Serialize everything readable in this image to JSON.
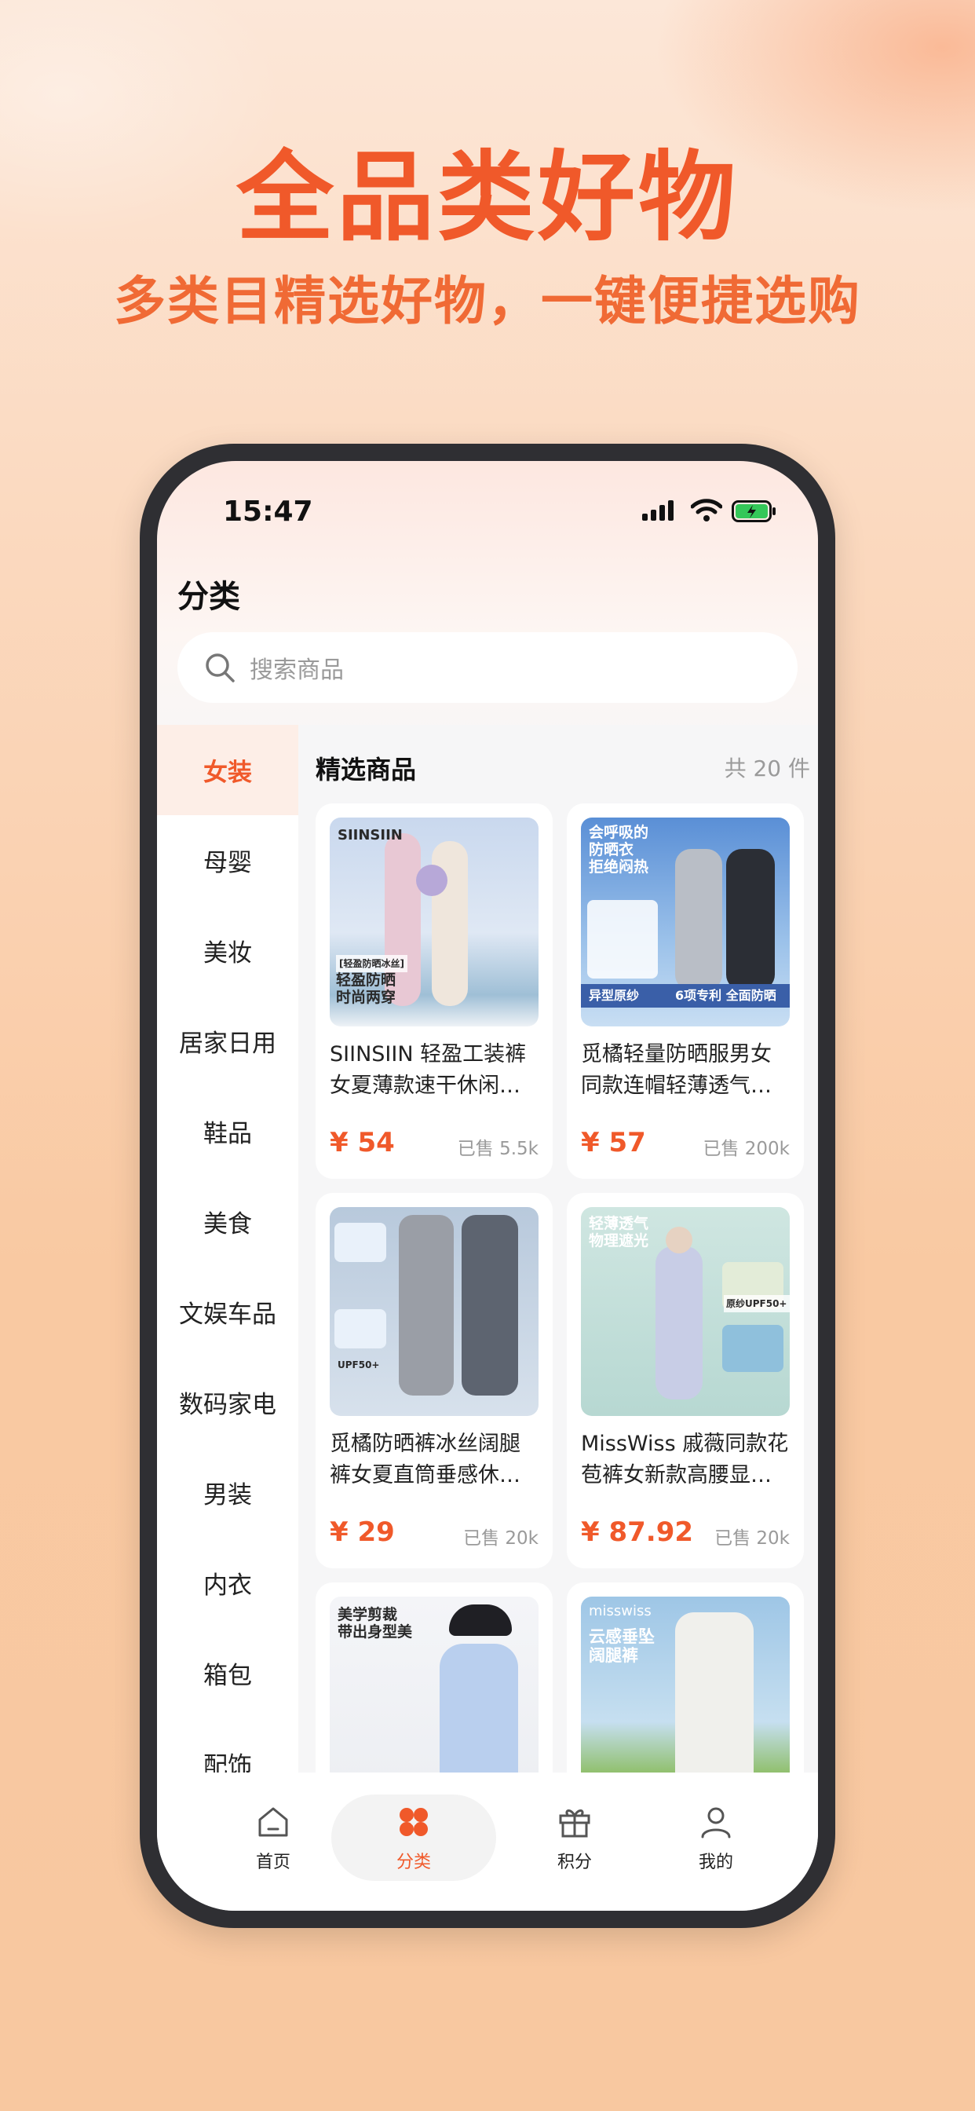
{
  "promo": {
    "headline": "全品类好物",
    "subhead": "多类目精选好物，一键便捷选购"
  },
  "status_bar": {
    "time": "15:47"
  },
  "page": {
    "title": "分类"
  },
  "search": {
    "placeholder": "搜索商品"
  },
  "sidebar": {
    "items": [
      {
        "label": "女装",
        "active": true
      },
      {
        "label": "母婴"
      },
      {
        "label": "美妆"
      },
      {
        "label": "居家日用"
      },
      {
        "label": "鞋品"
      },
      {
        "label": "美食"
      },
      {
        "label": "文娱车品"
      },
      {
        "label": "数码家电"
      },
      {
        "label": "男装"
      },
      {
        "label": "内衣"
      },
      {
        "label": "箱包"
      },
      {
        "label": "配饰"
      }
    ]
  },
  "section": {
    "title": "精选商品",
    "count": "共 20 件"
  },
  "products": [
    {
      "name": "SIINSIIN 轻盈工装裤女夏薄款速干休闲束脚裤",
      "price": "¥ 54",
      "sold": "已售 5.5k",
      "image_text": [
        "SIINSIIN",
        "[轻盈防晒冰丝]",
        "轻盈防晒",
        "时尚两穿"
      ]
    },
    {
      "name": "觅橘轻量防晒服男女同款连帽轻薄透气外套",
      "price": "¥ 57",
      "sold": "已售 200k",
      "image_text": [
        "会呼吸的",
        "防晒衣",
        "拒绝闷热",
        "异型原纱",
        "6项专利 全面防晒"
      ]
    },
    {
      "name": "觅橘防晒裤冰丝阔腿裤女夏直筒垂感休闲裤",
      "price": "¥ 29",
      "sold": "已售 20k",
      "image_text": [
        "UPF50+"
      ]
    },
    {
      "name": "MissWiss 戚薇同款花苞裤女新款高腰显瘦休闲裤",
      "price": "¥ 87.92",
      "sold": "已售 20k",
      "image_text": [
        "轻薄透气",
        "物理遮光",
        "原纱UPF50+"
      ]
    },
    {
      "name": "",
      "price": "",
      "sold": "",
      "image_text": [
        "美学剪裁",
        "带出身型美"
      ]
    },
    {
      "name": "",
      "price": "",
      "sold": "",
      "image_text": [
        "misswiss",
        "云感垂坠",
        "阔腿裤"
      ]
    }
  ],
  "tabbar": {
    "tabs": [
      {
        "label": "首页",
        "icon": "home-icon"
      },
      {
        "label": "分类",
        "icon": "category-icon",
        "active": true
      },
      {
        "label": "积分",
        "icon": "gift-icon"
      },
      {
        "label": "我的",
        "icon": "user-icon"
      }
    ]
  },
  "colors": {
    "accent": "#f0592a",
    "battery": "#34c759"
  }
}
